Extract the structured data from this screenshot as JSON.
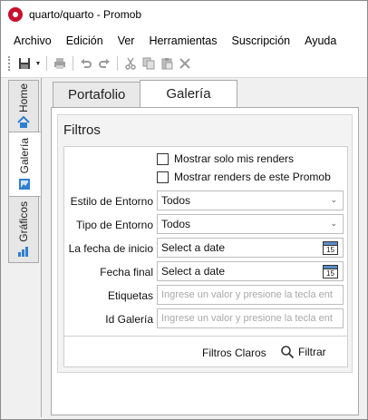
{
  "window": {
    "title": "quarto/quarto - Promob"
  },
  "menu": {
    "items": [
      "Archivo",
      "Edición",
      "Ver",
      "Herramientas",
      "Suscripción",
      "Ayuda"
    ]
  },
  "toolbar": {
    "icons": [
      "save-icon",
      "dropdown-arrow-icon",
      "print-icon",
      "undo-icon",
      "redo-icon",
      "cut-icon",
      "copy-icon",
      "paste-icon",
      "delete-icon"
    ]
  },
  "side_tabs": [
    {
      "label": "Home",
      "icon": "home-icon",
      "active": false
    },
    {
      "label": "Galería",
      "icon": "gallery-icon",
      "active": true
    },
    {
      "label": "Gráficos",
      "icon": "chart-icon",
      "active": false
    }
  ],
  "tabs": [
    {
      "label": "Portafolio",
      "active": false
    },
    {
      "label": "Galería",
      "active": true
    }
  ],
  "filters": {
    "title": "Filtros",
    "checkboxes": [
      {
        "label": "Mostrar solo mis renders",
        "checked": false
      },
      {
        "label": "Mostrar renders de este Promob",
        "checked": false
      }
    ],
    "fields": {
      "environment_style": {
        "label": "Estilo de Entorno",
        "value": "Todos"
      },
      "environment_type": {
        "label": "Tipo de Entorno",
        "value": "Todos"
      },
      "start_date": {
        "label": "La fecha de inicio",
        "value": "Select a date",
        "calendar_day": "15"
      },
      "end_date": {
        "label": "Fecha final",
        "value": "Select a date",
        "calendar_day": "15"
      },
      "tags": {
        "label": "Etiquetas",
        "placeholder": "Ingrese un valor y presione la tecla ent"
      },
      "gallery_id": {
        "label": "Id Galería",
        "placeholder": "Ingrese un valor y presione la tecla ent"
      }
    },
    "clear_label": "Filtros Claros",
    "filter_label": "Filtrar"
  },
  "colors": {
    "brand_red": "#c8102e",
    "tab_icon_blue": "#2f7fd1"
  }
}
